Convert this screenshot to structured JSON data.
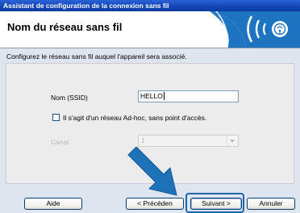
{
  "window": {
    "title": "Assistant de configuration de la connexion sans fil"
  },
  "header": {
    "title": "Nom du réseau sans fil",
    "icon": "wireless-signal-icon"
  },
  "instruction": "Configurez le réseau sans fil auquel l'appareil sera associé.",
  "ssid": {
    "label": "Nom (SSID)",
    "value": "HELLO"
  },
  "adhoc": {
    "label": "Il s'agit d'un réseau Ad-hoc, sans point d'accès.",
    "checked": false
  },
  "canal": {
    "label": "Canal",
    "value": "1",
    "enabled": false
  },
  "buttons": {
    "aide": "Aide",
    "precedent": "< Précéden",
    "suivant": "Suivant >",
    "annuler": "Annuler"
  },
  "colors": {
    "titlebar": "#1245b5",
    "background": "#dfe5ee",
    "highlight": "#1865b0",
    "arrow": "#1e73b8"
  }
}
